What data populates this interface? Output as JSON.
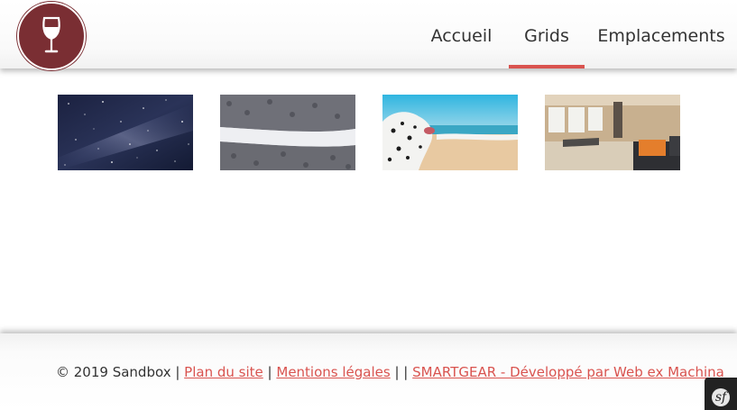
{
  "header": {
    "logo_icon": "wine-glass-icon",
    "logo_color": "#7a2e33",
    "nav": [
      {
        "label": "Accueil",
        "active": false
      },
      {
        "label": "Grids",
        "active": true
      },
      {
        "label": "Emplacements",
        "active": false
      }
    ],
    "active_color": "#d9534f"
  },
  "gallery": [
    {
      "subject": "milky-way-night-sky"
    },
    {
      "subject": "snowy-forest-road-aerial"
    },
    {
      "subject": "dalmatian-dog-on-beach"
    },
    {
      "subject": "living-room-interior"
    }
  ],
  "footer": {
    "copyright": "© 2019 Sandbox |",
    "link_sitemap": "Plan du site",
    "sep1": "|",
    "link_legal": "Mentions légales",
    "sep2": "| |",
    "link_smartgear": "SMARTGEAR - Développé par Web ex Machina",
    "link_color": "#d9534f"
  },
  "symfony_toolbar": {
    "icon": "symfony-icon",
    "glyph": "sf"
  }
}
